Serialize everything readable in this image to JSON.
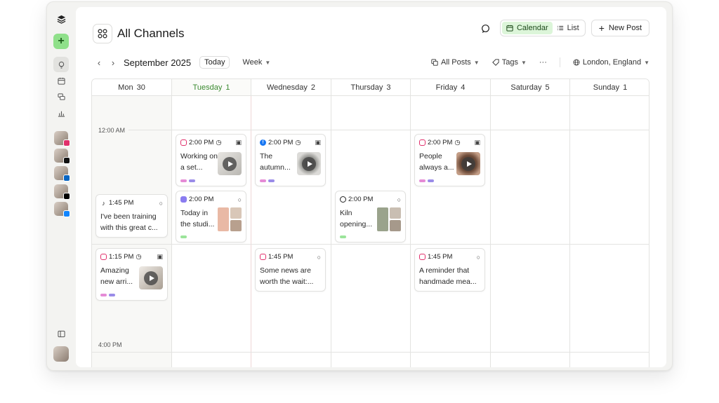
{
  "header": {
    "title": "All Channels",
    "view_calendar": "Calendar",
    "view_list": "List",
    "new_post": "New Post"
  },
  "toolbar": {
    "month": "September 2025",
    "today": "Today",
    "range": "Week",
    "filter_posts": "All Posts",
    "filter_tags": "Tags",
    "more": "···",
    "timezone": "London, England"
  },
  "days": [
    {
      "name": "Mon",
      "num": "30"
    },
    {
      "name": "Tuesday",
      "num": "1"
    },
    {
      "name": "Wednesday",
      "num": "2"
    },
    {
      "name": "Thursday",
      "num": "3"
    },
    {
      "name": "Friday",
      "num": "4"
    },
    {
      "name": "Saturday",
      "num": "5"
    },
    {
      "name": "Sunday",
      "num": "1"
    }
  ],
  "times": {
    "t1": "12:00 AM",
    "t2": "4:00 PM"
  },
  "colors": {
    "accent_green": "#8fe08a",
    "instagram": "#e1306c",
    "facebook": "#1877f2",
    "tag_pink": "#e58bd6",
    "tag_purple": "#9a8ce8",
    "tag_green": "#9be49a"
  },
  "posts": {
    "p1": {
      "time": "2:00 PM",
      "text": "Working on a set..."
    },
    "p2": {
      "time": "2:00 PM",
      "text": "Today in the studi..."
    },
    "p3": {
      "time": "2:00 PM",
      "text": "The autumn..."
    },
    "p4": {
      "time": "2:00 PM",
      "text": "Kiln opening..."
    },
    "p5": {
      "time": "2:00 PM",
      "text": "People always a..."
    },
    "p6": {
      "time": "1:45 PM",
      "text": "I've been training with this great c..."
    },
    "p7": {
      "time": "1:15 PM",
      "text": "Amazing new arri..."
    },
    "p8": {
      "time": "1:45 PM",
      "text": "Some news are worth the wait:..."
    },
    "p9": {
      "time": "1:45 PM",
      "text": "A reminder that handmade mea..."
    }
  }
}
